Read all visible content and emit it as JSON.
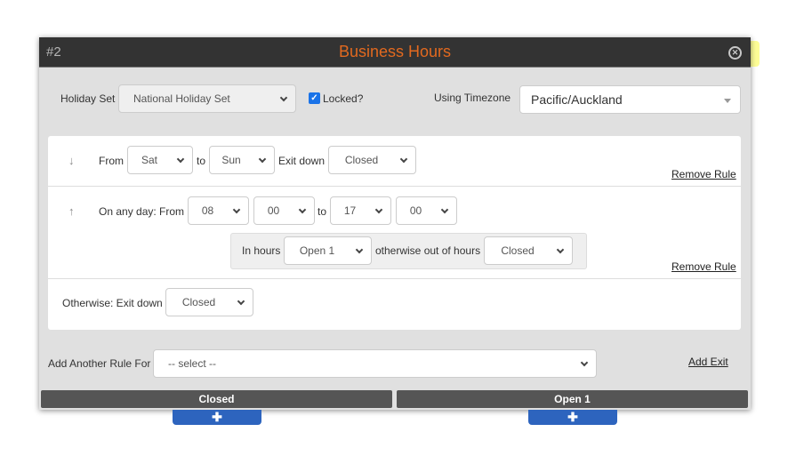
{
  "dialog": {
    "node_id": "#2",
    "title": "Business Hours",
    "close_icon": "circle-x-icon"
  },
  "header": {
    "holiday_set_label": "Holiday Set",
    "holiday_set_value": "National Holiday Set",
    "locked_label": "Locked?",
    "locked_checked": true,
    "timezone_label": "Using Timezone",
    "timezone_value": "Pacific/Auckland"
  },
  "rules": [
    {
      "move_icon": "arrow-down-icon",
      "from_label": "From",
      "from_day": "Sat",
      "to_label": "to",
      "to_day": "Sun",
      "exit_label": "Exit down",
      "exit_value": "Closed",
      "remove_label": "Remove Rule"
    },
    {
      "move_icon": "arrow-up-icon",
      "from_label": "On any day: From",
      "from_hour": "08",
      "from_minute": "00",
      "to_label": "to",
      "to_hour": "17",
      "to_minute": "00",
      "in_hours_label": "In hours",
      "in_hours_value": "Open 1",
      "out_hours_label": "otherwise out of hours",
      "out_hours_value": "Closed",
      "remove_label": "Remove Rule"
    }
  ],
  "otherwise": {
    "label": "Otherwise: Exit down",
    "value": "Closed"
  },
  "add_rule": {
    "label": "Add Another Rule For",
    "value": "-- select --",
    "add_exit_label": "Add Exit"
  },
  "exits": [
    {
      "label": "Closed",
      "add_icon": "plus-icon"
    },
    {
      "label": "Open 1",
      "add_icon": "plus-icon"
    }
  ],
  "colors": {
    "title": "#e2691f",
    "titlebar": "#333333",
    "exit_bar": "#555555",
    "add_button": "#2d64be",
    "checkbox": "#1a73e8"
  }
}
